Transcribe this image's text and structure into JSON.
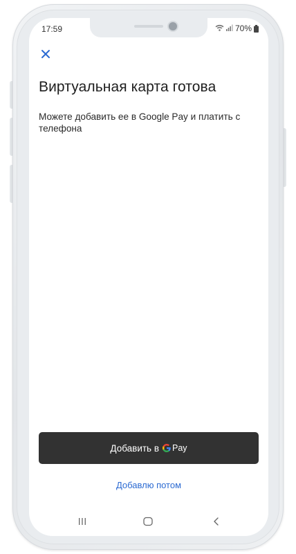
{
  "status_bar": {
    "time": "17:59",
    "battery": "70%"
  },
  "icons": {
    "close": "close-icon",
    "wifi": "wifi-icon",
    "signal": "signal-icon",
    "battery": "battery-icon",
    "google_g": "google-g-icon",
    "recents": "recents-icon",
    "home": "home-icon",
    "back": "back-icon"
  },
  "colors": {
    "close_icon": "#2b6ad2",
    "button_bg": "#323232",
    "button_text": "#ffffff",
    "link": "#2b6ad2"
  },
  "main": {
    "title": "Виртуальная карта готова",
    "subtitle": "Можете добавить ее в Google Pay и платить с телефона"
  },
  "actions": {
    "add_button_prefix": "Добавить в",
    "add_button_pay": "Pay",
    "later_link": "Добавлю потом"
  }
}
